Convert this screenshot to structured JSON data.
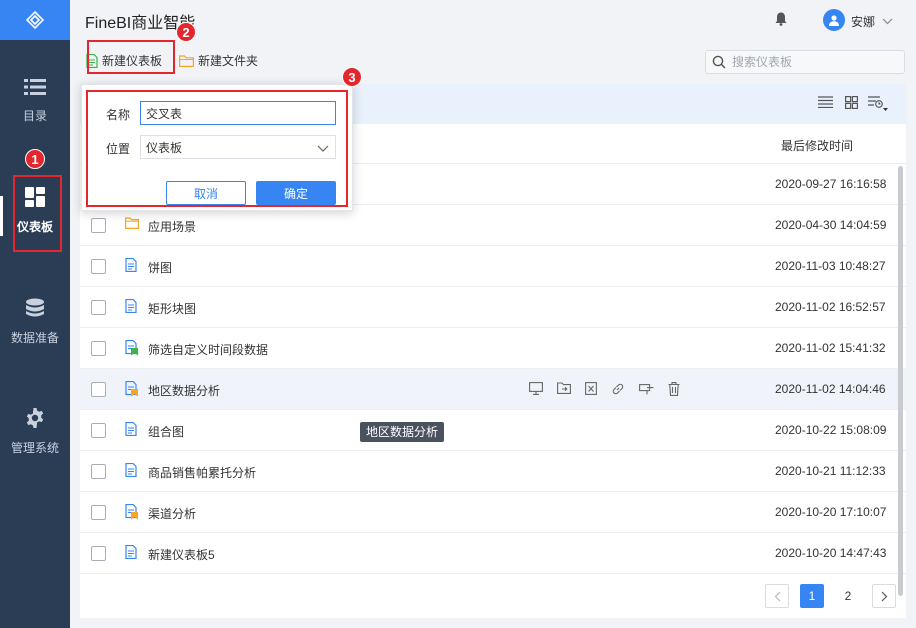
{
  "app": {
    "title": "FineBI商业智能"
  },
  "user": {
    "name": "安娜"
  },
  "sidebar": {
    "items": [
      {
        "label": "目录",
        "icon": "list-icon"
      },
      {
        "label": "仪表板",
        "icon": "dashboard-icon",
        "active": true
      },
      {
        "label": "数据准备",
        "icon": "database-icon"
      },
      {
        "label": "管理系统",
        "icon": "gear-icon"
      }
    ]
  },
  "toolbar": {
    "new_dashboard_label": "新建仪表板",
    "new_folder_label": "新建文件夹",
    "search_placeholder": "搜索仪表板"
  },
  "table": {
    "time_header": "最后修改时间",
    "rows": [
      {
        "name": "",
        "time": "2020-09-27 16:16:58",
        "icon": "folder-icon"
      },
      {
        "name": "应用场景",
        "time": "2020-04-30 14:04:59",
        "icon": "folder-icon"
      },
      {
        "name": "饼图",
        "time": "2020-11-03 10:48:27",
        "icon": "dashboard-file-icon"
      },
      {
        "name": "矩形块图",
        "time": "2020-11-02 16:52:57",
        "icon": "dashboard-file-icon"
      },
      {
        "name": "筛选自定义时间段数据",
        "time": "2020-11-02 15:41:32",
        "icon": "dashboard-file-green-tag-icon"
      },
      {
        "name": "地区数据分析",
        "time": "2020-11-02 14:04:46",
        "icon": "dashboard-file-orange-tag-icon"
      },
      {
        "name": "组合图",
        "time": "2020-10-22 15:08:09",
        "icon": "dashboard-file-icon"
      },
      {
        "name": "商品销售帕累托分析",
        "time": "2020-10-21 11:12:33",
        "icon": "dashboard-file-icon"
      },
      {
        "name": "渠道分析",
        "time": "2020-10-20 17:10:07",
        "icon": "dashboard-file-orange-tag-icon"
      },
      {
        "name": "新建仪表板5",
        "time": "2020-10-20 14:47:43",
        "icon": "dashboard-file-icon"
      }
    ]
  },
  "tooltip": {
    "text": "地区数据分析"
  },
  "dialog": {
    "name_label": "名称",
    "name_value": "交叉表",
    "location_label": "位置",
    "location_value": "仪表板",
    "cancel_label": "取消",
    "ok_label": "确定"
  },
  "pagination": {
    "pages": [
      "1",
      "2"
    ],
    "current": "1"
  },
  "markers": [
    "1",
    "2",
    "3"
  ],
  "colors": {
    "accent": "#3685f2",
    "sidebar": "#2b3c55",
    "annotation": "#e4262d"
  }
}
